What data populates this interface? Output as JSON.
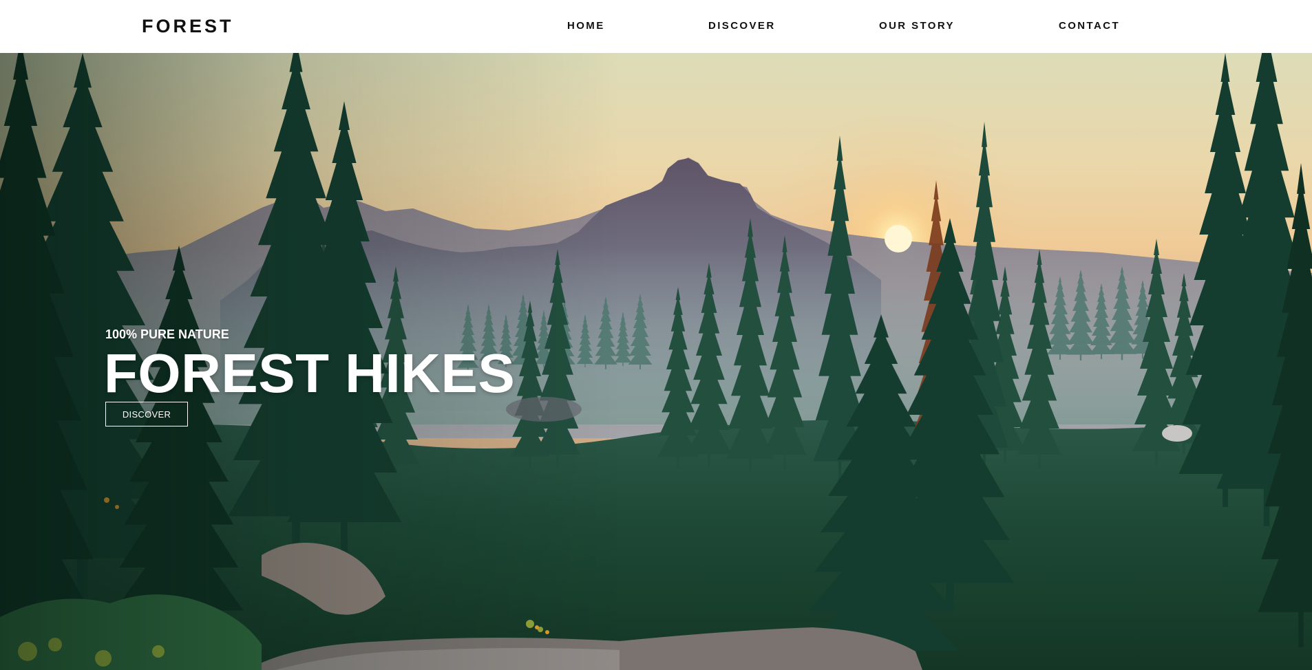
{
  "header": {
    "logo": "FOREST",
    "nav": {
      "home": "HOME",
      "discover": "DISCOVER",
      "our_story": "OUR STORY",
      "contact": "CONTACT"
    }
  },
  "hero": {
    "subtitle": "100% PURE NATURE",
    "title": "FOREST HIKES",
    "button_label": "DISCOVER"
  },
  "colors": {
    "header_background": "#ffffff",
    "header_text": "#111111",
    "hero_text": "#ffffff",
    "sky_top": "#dcd9b6",
    "sky_horizon": "#f3c792",
    "forest_green": "#1e4f3c",
    "sun": "#fff3c4"
  }
}
